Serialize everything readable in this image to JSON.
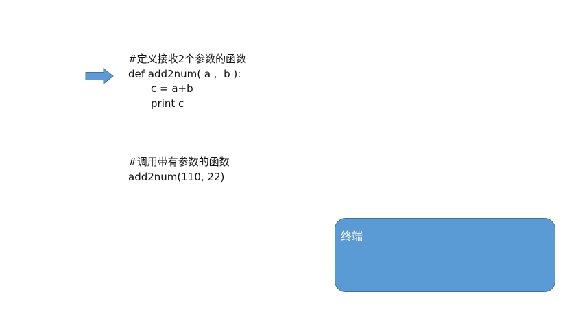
{
  "definition": {
    "comment": "#定义接收2个参数的函数",
    "signature": "def add2num( a ,  b ):",
    "body_line1": "c = a+b",
    "body_line2": "print c"
  },
  "call": {
    "comment": "#调用带有参数的函数",
    "statement": "add2num(110, 22)"
  },
  "terminal": {
    "label": "终端"
  },
  "colors": {
    "arrow_fill": "#5b9bd5",
    "arrow_stroke": "#41719c",
    "terminal_fill": "#5b9bd5",
    "text": "#111111"
  }
}
